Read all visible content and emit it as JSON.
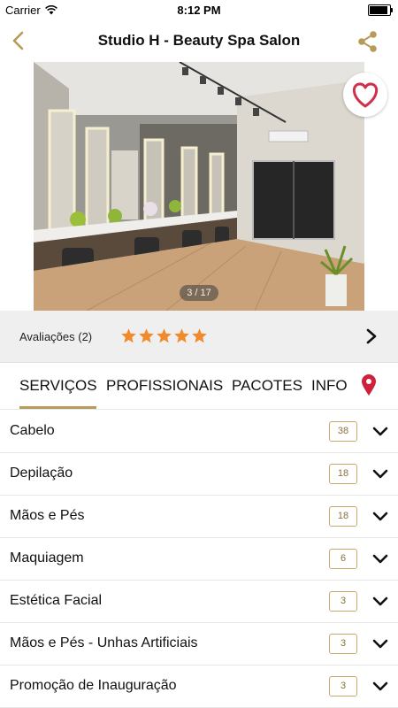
{
  "status_bar": {
    "carrier": "Carrier",
    "time": "8:12 PM",
    "battery_level": 1.0
  },
  "nav": {
    "title": "Studio H - Beauty Spa Salon",
    "back_icon": "chevron-left-icon",
    "share_icon": "share-icon"
  },
  "gallery": {
    "counter": "3 / 17",
    "favorite_icon": "heart-outline-icon"
  },
  "ratings": {
    "label": "Avaliações (2)",
    "stars": 5,
    "max_stars": 5,
    "star_color": "#f08a2a"
  },
  "tabs": [
    {
      "label": "SERVIÇOS",
      "active": true
    },
    {
      "label": "PROFISSIONAIS",
      "active": false
    },
    {
      "label": "PACOTES",
      "active": false
    },
    {
      "label": "INFO",
      "active": false
    }
  ],
  "map_icon": "map-pin-icon",
  "services": [
    {
      "label": "Cabelo",
      "count": "38"
    },
    {
      "label": "Depilação",
      "count": "18"
    },
    {
      "label": "Mãos e Pés",
      "count": "18"
    },
    {
      "label": "Maquiagem",
      "count": "6"
    },
    {
      "label": "Estética Facial",
      "count": "3"
    },
    {
      "label": "Mãos e Pés - Unhas Artificiais",
      "count": "3"
    },
    {
      "label": "Promoção de Inauguração",
      "count": "3"
    }
  ],
  "colors": {
    "accent": "#b89a5a",
    "favorite": "#d0314a",
    "map_pin": "#d0213a",
    "badge_border": "#c9a96a"
  }
}
